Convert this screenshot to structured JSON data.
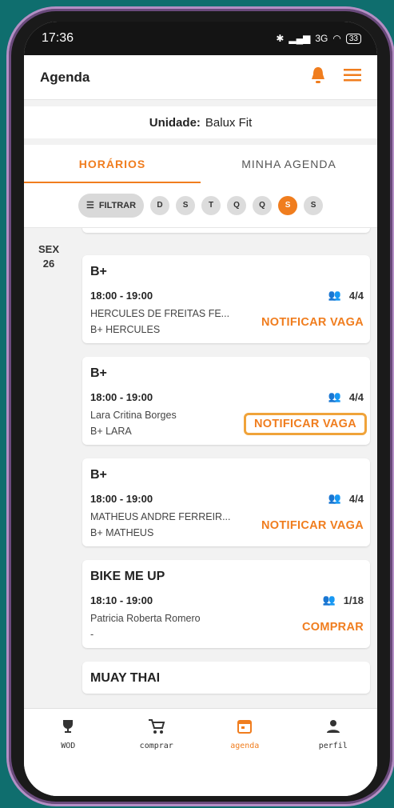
{
  "status": {
    "time": "17:36",
    "network": "3G",
    "battery": "33"
  },
  "appbar": {
    "title": "Agenda"
  },
  "unit": {
    "label": "Unidade:",
    "value": "Balux Fit"
  },
  "tabs": [
    {
      "label": "HORÁRIOS",
      "active": true
    },
    {
      "label": "MINHA AGENDA",
      "active": false
    }
  ],
  "filter": {
    "label": "FILTRAR"
  },
  "days": [
    "D",
    "S",
    "T",
    "Q",
    "Q",
    "S",
    "S"
  ],
  "date": {
    "weekday": "SEX",
    "day": "26"
  },
  "cards": [
    {
      "title": "B+",
      "time": "18:00 - 19:00",
      "capacity": "4/4",
      "person": "HERCULES DE FREITAS FE...",
      "group": "B+ HERCULES",
      "action": "NOTIFICAR VAGA"
    },
    {
      "title": "B+",
      "time": "18:00 - 19:00",
      "capacity": "4/4",
      "person": "Lara Critina Borges",
      "group": "B+ LARA",
      "action": "NOTIFICAR VAGA"
    },
    {
      "title": "B+",
      "time": "18:00 - 19:00",
      "capacity": "4/4",
      "person": "MATHEUS ANDRE FERREIR...",
      "group": "B+ MATHEUS",
      "action": "NOTIFICAR VAGA"
    },
    {
      "title": "BIKE ME UP",
      "time": "18:10 - 19:00",
      "capacity": "1/18",
      "person": "Patricia Roberta Romero",
      "group": "-",
      "action": "COMPRAR"
    },
    {
      "title": "MUAY THAI"
    }
  ],
  "nav": [
    {
      "label": "WOD",
      "icon": "trophy-icon"
    },
    {
      "label": "comprar",
      "icon": "cart-icon"
    },
    {
      "label": "agenda",
      "icon": "calendar-icon"
    },
    {
      "label": "perfil",
      "icon": "person-icon"
    }
  ],
  "colors": {
    "accent": "#f07d1e",
    "highlight": "#f0a33a"
  }
}
